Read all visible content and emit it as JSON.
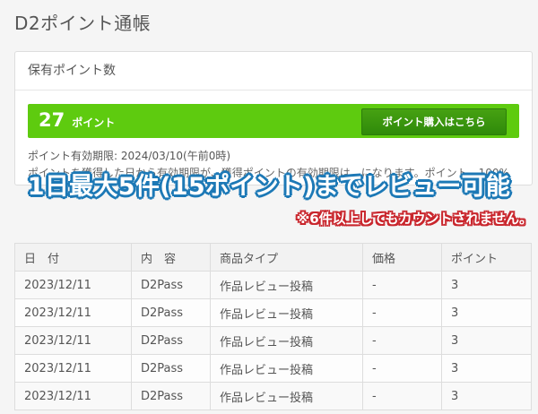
{
  "page": {
    "title": "D2ポイント通帳"
  },
  "points_card": {
    "header": "保有ポイント数",
    "points_value": "27",
    "points_unit": "ポイント",
    "buy_button_label": "ポイント購入はこちら",
    "expiry_text": "ポイント有効期限: 2024/03/10(午前0時)",
    "partial_text": "ポイントを獲得した日から有効期限が、獲得ポイントの有効期限は、になります。ポイント…100%"
  },
  "overlay": {
    "main_text": "1日最大5件(15ポイント)までレビュー可能",
    "sub_text": "※6件以上してもカウントされません。"
  },
  "history_table": {
    "columns": [
      "日　付",
      "内　容",
      "商品タイプ",
      "価格",
      "ポイント"
    ],
    "rows": [
      [
        "2023/12/11",
        "D2Pass",
        "作品レビュー投稿",
        "-",
        "3"
      ],
      [
        "2023/12/11",
        "D2Pass",
        "作品レビュー投稿",
        "-",
        "3"
      ],
      [
        "2023/12/11",
        "D2Pass",
        "作品レビュー投稿",
        "-",
        "3"
      ],
      [
        "2023/12/11",
        "D2Pass",
        "作品レビュー投稿",
        "-",
        "3"
      ],
      [
        "2023/12/11",
        "D2Pass",
        "作品レビュー投稿",
        "-",
        "3"
      ]
    ]
  },
  "colors": {
    "points_bar": "#5ecb0f",
    "buy_button": "#3a9410",
    "banner_outline": "#1d79b6",
    "sub_outline": "#c9262d"
  }
}
